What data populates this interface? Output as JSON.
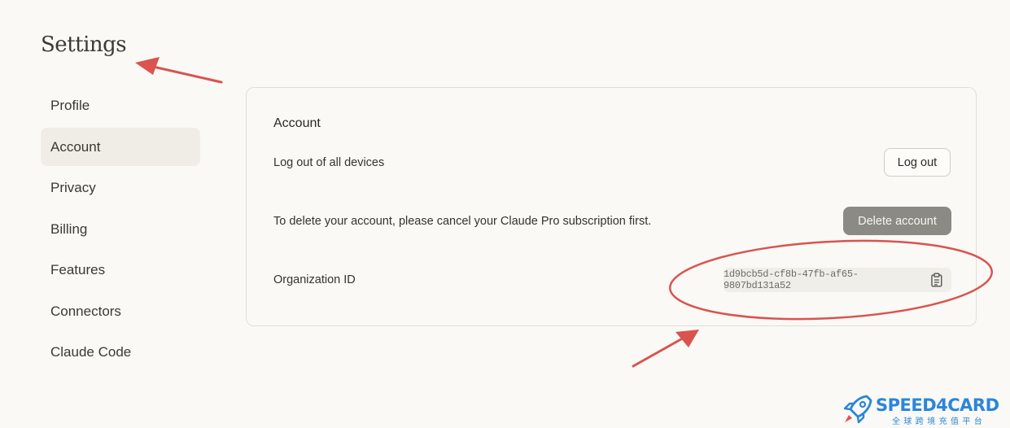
{
  "page": {
    "title": "Settings"
  },
  "sidebar": {
    "active_index": 1,
    "items": [
      {
        "label": "Profile"
      },
      {
        "label": "Account"
      },
      {
        "label": "Privacy"
      },
      {
        "label": "Billing"
      },
      {
        "label": "Features"
      },
      {
        "label": "Connectors"
      },
      {
        "label": "Claude Code"
      }
    ]
  },
  "account": {
    "section_title": "Account",
    "logout": {
      "label": "Log out of all devices",
      "button": "Log out"
    },
    "delete": {
      "label": "To delete your account, please cancel your Claude Pro subscription first.",
      "button": "Delete account"
    },
    "org": {
      "label": "Organization ID",
      "value": "1d9bcb5d-cf8b-47fb-af65-9807bd131a52",
      "icon": "clipboard-icon"
    }
  },
  "annotations": {
    "color": "#d9534f"
  },
  "watermark": {
    "name": "SPEED4CARD",
    "tagline": "全球跨境充值平台",
    "color": "#2a86d9"
  }
}
